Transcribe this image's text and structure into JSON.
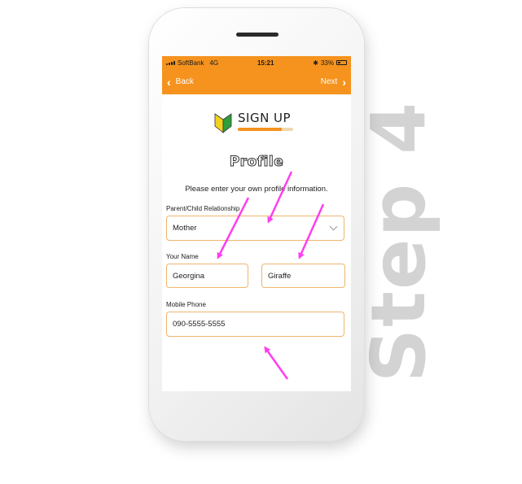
{
  "step_label": "Step 4",
  "status_bar": {
    "carrier": "SoftBank",
    "network": "4G",
    "time": "15:21",
    "bluetooth_icon": "bluetooth-icon",
    "battery": "33%"
  },
  "nav": {
    "back_label": "Back",
    "next_label": "Next"
  },
  "header": {
    "logo_text": "SIGN UP",
    "logo_icon": "beginner-leaf-icon",
    "progress": 0.8
  },
  "page": {
    "title": "Profile",
    "instruction": "Please enter your own profile information."
  },
  "form": {
    "relationship_label": "Parent/Child Relationship",
    "relationship_value": "Mother",
    "name_label": "Your Name",
    "first_name": "Georgina",
    "last_name": "Giraffe",
    "phone_label": "Mobile Phone",
    "phone_value": "090-5555-5555"
  },
  "colors": {
    "accent": "#f5931e",
    "field_border": "#f0b56c",
    "annotation_arrow": "#ff3ef0",
    "step_text": "#d3d3d3"
  }
}
